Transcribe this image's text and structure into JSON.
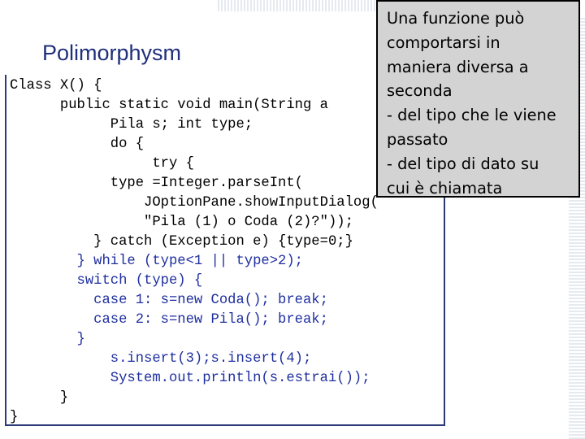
{
  "slide": {
    "title": "Polimorphysm",
    "code_lines": [
      {
        "text": "Class X() {",
        "blue": false
      },
      {
        "text": "      public static void main(String a",
        "blue": false
      },
      {
        "text": "            Pila s; int type;",
        "blue": false
      },
      {
        "text": "            do {",
        "blue": false
      },
      {
        "text": "                 try {",
        "blue": false
      },
      {
        "text": "            type =Integer.parseInt(",
        "blue": false
      },
      {
        "text": "                JOptionPane.showInputDialog(",
        "blue": false
      },
      {
        "text": "                \"Pila (1) o Coda (2)?\"));",
        "blue": false
      },
      {
        "text": "          } catch (Exception e) {type=0;}",
        "blue": false
      },
      {
        "text": "        } while (type<1 || type>2);",
        "blue": true
      },
      {
        "text": "        switch (type) {",
        "blue": true
      },
      {
        "text": "          case 1: s=new Coda(); break;",
        "blue": true
      },
      {
        "text": "          case 2: s=new Pila(); break;",
        "blue": true
      },
      {
        "text": "        }",
        "blue": true
      },
      {
        "text": "            s.insert(3);s.insert(4);",
        "blue": true
      },
      {
        "text": "            System.out.println(s.estrai());",
        "blue": true
      },
      {
        "text": "      }",
        "blue": false
      },
      {
        "text": "}",
        "blue": false
      }
    ],
    "callout_lines": [
      "Una funzione può",
      "comportarsi in",
      "maniera diversa a",
      "seconda",
      "- del tipo che le viene",
      "passato",
      "- del tipo di dato su",
      "cui è chiamata"
    ]
  },
  "colors": {
    "title": "#1f2f7a",
    "code_blue": "#1f2fa0",
    "callout_bg": "#d3d3d3",
    "box_border": "#2c3a78"
  }
}
